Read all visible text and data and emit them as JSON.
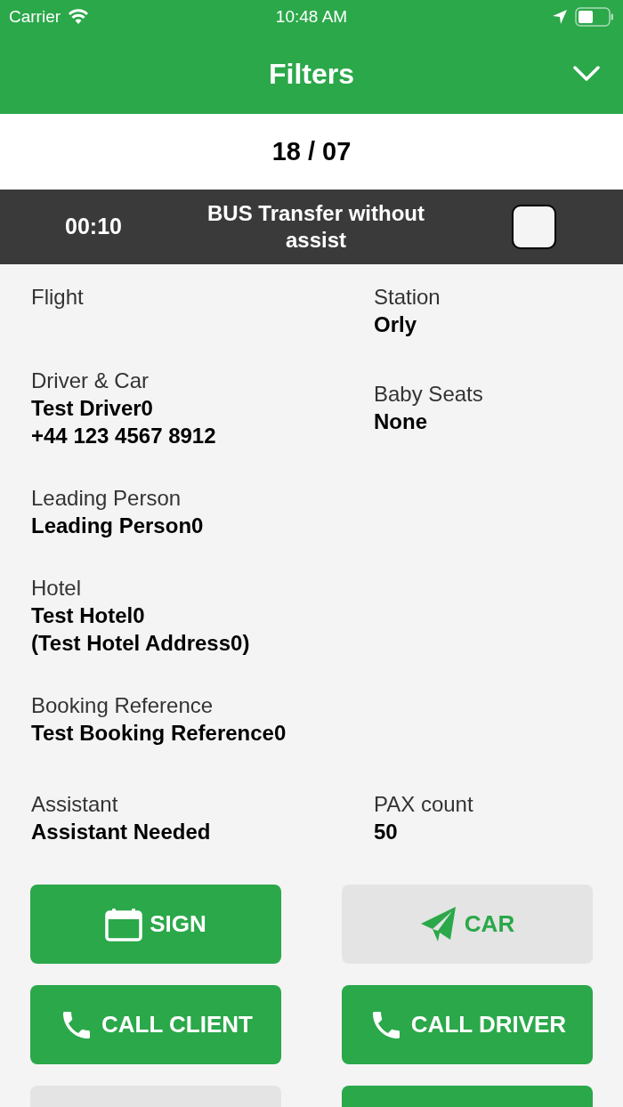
{
  "status_bar": {
    "carrier": "Carrier",
    "time": "10:48 AM"
  },
  "header": {
    "title": "Filters"
  },
  "date": "18 / 07",
  "transfer": {
    "time": "00:10",
    "title": "BUS Transfer without assist",
    "checked": false
  },
  "rows": [
    {
      "fields": [
        {
          "label": "Flight"
        },
        {
          "label": "Station",
          "lines": [
            "Orly"
          ]
        }
      ]
    },
    {
      "fields": [
        {
          "label": "Driver & Car",
          "lines": [
            "Test Driver0",
            "+44 123 4567 8912"
          ]
        },
        {
          "label": "Baby Seats",
          "lines": [
            "None"
          ]
        }
      ]
    },
    {
      "fields": [
        {
          "label": "Leading Person",
          "lines": [
            "Leading Person0"
          ]
        }
      ]
    },
    {
      "fields": [
        {
          "label": "Hotel",
          "lines": [
            "Test Hotel0",
            "(Test Hotel Address0)"
          ]
        }
      ]
    },
    {
      "fields": [
        {
          "label": "Booking Reference",
          "lines": [
            "Test Booking Reference0"
          ]
        }
      ]
    },
    {
      "fields": [
        {
          "label": "Assistant",
          "lines": [
            "Assistant Needed"
          ]
        },
        {
          "label": "PAX count",
          "lines": [
            "50"
          ]
        }
      ]
    }
  ],
  "buttons": [
    {
      "label": "SIGN",
      "kind": "primary"
    },
    {
      "label": "CAR",
      "kind": "secondary"
    },
    {
      "label": "CALL CLIENT",
      "kind": "primary"
    },
    {
      "label": "CALL DRIVER",
      "kind": "primary"
    },
    {
      "kind": "secondary"
    },
    {
      "kind": "primary"
    }
  ]
}
